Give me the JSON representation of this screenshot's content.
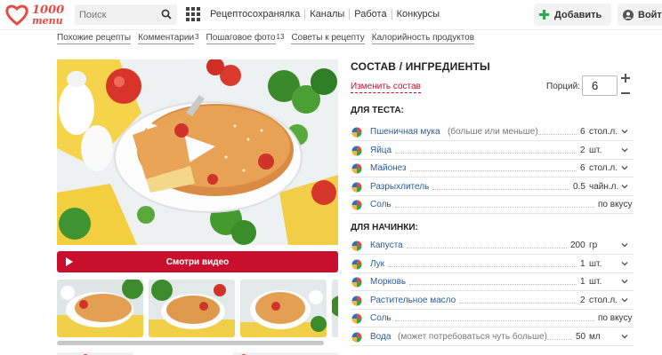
{
  "header": {
    "logo_line1": "1000",
    "logo_line2": "menu",
    "search_placeholder": "Поиск",
    "nav": [
      "Рецептосохранялка",
      "Каналы",
      "Работа",
      "Конкурсы"
    ],
    "add_label": "Добавить",
    "login_label": "Войти"
  },
  "subnav": {
    "similar": "Похожие рецепты",
    "comments": "Комментарии",
    "comments_count": "3",
    "stepphoto": "Пошаговое фото",
    "stepphoto_count": "13",
    "tips": "Советы к рецепту",
    "calories": "Калорийность продуктов"
  },
  "media": {
    "video_label": "Смотри видео"
  },
  "ingredients": {
    "title": "СОСТАВ / ИНГРЕДИЕНТЫ",
    "change_link": "Изменить состав",
    "portions_label": "Порций:",
    "portions_value": "6",
    "sections": [
      {
        "title": "ДЛЯ ТЕСТА:",
        "items": [
          {
            "name": "Пшеничная мука",
            "note": "(больше или меньше)",
            "amount": "6",
            "unit": "стол.л."
          },
          {
            "name": "Яйца",
            "note": "",
            "amount": "2",
            "unit": "шт."
          },
          {
            "name": "Майонез",
            "note": "",
            "amount": "6",
            "unit": "стол.л."
          },
          {
            "name": "Разрыхлитель",
            "note": "",
            "amount": "0.5",
            "unit": "чайн.л."
          },
          {
            "name": "Соль",
            "note": "",
            "amount": "",
            "unit": "по вкусу"
          }
        ]
      },
      {
        "title": "ДЛЯ НАЧИНКИ:",
        "items": [
          {
            "name": "Капуста",
            "note": "",
            "amount": "200",
            "unit": "гр"
          },
          {
            "name": "Лук",
            "note": "",
            "amount": "1",
            "unit": "шт."
          },
          {
            "name": "Морковь",
            "note": "",
            "amount": "1",
            "unit": "шт."
          },
          {
            "name": "Растительное масло",
            "note": "",
            "amount": "2",
            "unit": "стол.л."
          },
          {
            "name": "Соль",
            "note": "",
            "amount": "",
            "unit": "по вкусу"
          },
          {
            "name": "Вода",
            "note": "(может потребоваться чуть больше)",
            "amount": "50",
            "unit": "мл"
          }
        ]
      }
    ]
  },
  "colors": {
    "brand_red": "#c8102e",
    "link_blue": "#2a5b9a",
    "accent_green": "#2ea84a"
  }
}
